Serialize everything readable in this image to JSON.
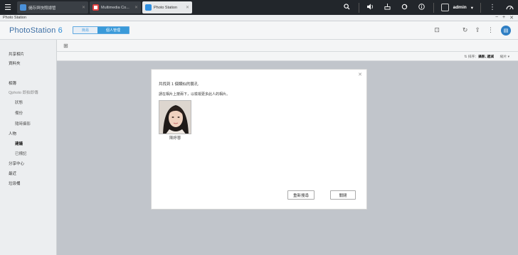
{
  "taskbar": {
    "tabs": [
      {
        "label": "儲存與快照總管",
        "color": "#4a90d9"
      },
      {
        "label": "Multimedia Co...",
        "color": "#e04040"
      },
      {
        "label": "Photo Station",
        "color": "#2f8fe0"
      }
    ],
    "user": "admin"
  },
  "window": {
    "title": "Photo Station"
  },
  "app": {
    "logo": "PhotoStation",
    "version": "6",
    "segments": [
      "簡易",
      "個人管理"
    ]
  },
  "sidebar": {
    "items": [
      {
        "label": "共享相片"
      },
      {
        "label": "資料夾"
      },
      {
        "label": "相簿"
      },
      {
        "label": "Qphoto 即拍即傳"
      },
      {
        "label": "狀態"
      },
      {
        "label": "備份"
      },
      {
        "label": "隨時攝影"
      },
      {
        "label": "人物"
      },
      {
        "label": "建議"
      },
      {
        "label": "已標記"
      },
      {
        "label": "分享中心"
      },
      {
        "label": "最近"
      },
      {
        "label": "垃圾桶"
      }
    ]
  },
  "sort": {
    "prefix": "排序",
    "value": "攝影, 遞減",
    "dir": "縮片"
  },
  "modal": {
    "line1": "共找到 1 個類似的臉孔",
    "line2": "請在相片上按兩下，以檢視更多此人的相片。",
    "face_name": "陳婷蓉",
    "rescan_label": "重新搜尋",
    "close_label": "關閉"
  },
  "colors": {
    "accent": "#2a8bd6",
    "overlay": "#c1c5cb"
  }
}
